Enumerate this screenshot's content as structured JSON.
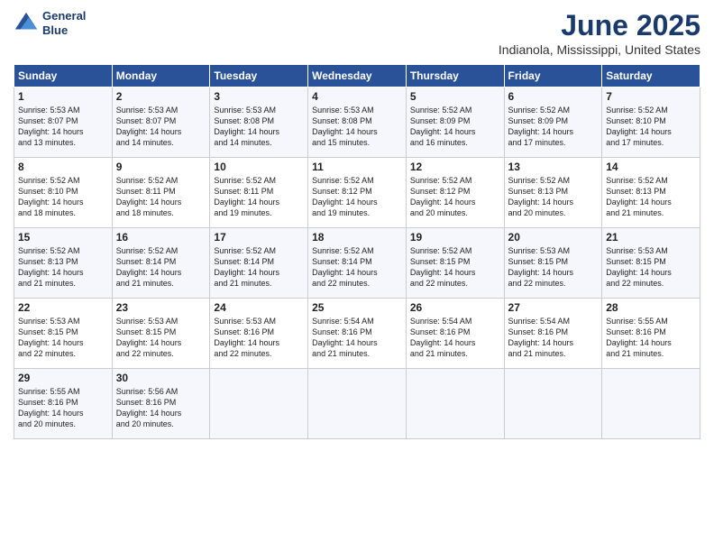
{
  "header": {
    "logo_line1": "General",
    "logo_line2": "Blue",
    "month_title": "June 2025",
    "location": "Indianola, Mississippi, United States"
  },
  "days_of_week": [
    "Sunday",
    "Monday",
    "Tuesday",
    "Wednesday",
    "Thursday",
    "Friday",
    "Saturday"
  ],
  "weeks": [
    [
      {
        "day": "1",
        "text": "Sunrise: 5:53 AM\nSunset: 8:07 PM\nDaylight: 14 hours\nand 13 minutes."
      },
      {
        "day": "2",
        "text": "Sunrise: 5:53 AM\nSunset: 8:07 PM\nDaylight: 14 hours\nand 14 minutes."
      },
      {
        "day": "3",
        "text": "Sunrise: 5:53 AM\nSunset: 8:08 PM\nDaylight: 14 hours\nand 14 minutes."
      },
      {
        "day": "4",
        "text": "Sunrise: 5:53 AM\nSunset: 8:08 PM\nDaylight: 14 hours\nand 15 minutes."
      },
      {
        "day": "5",
        "text": "Sunrise: 5:52 AM\nSunset: 8:09 PM\nDaylight: 14 hours\nand 16 minutes."
      },
      {
        "day": "6",
        "text": "Sunrise: 5:52 AM\nSunset: 8:09 PM\nDaylight: 14 hours\nand 17 minutes."
      },
      {
        "day": "7",
        "text": "Sunrise: 5:52 AM\nSunset: 8:10 PM\nDaylight: 14 hours\nand 17 minutes."
      }
    ],
    [
      {
        "day": "8",
        "text": "Sunrise: 5:52 AM\nSunset: 8:10 PM\nDaylight: 14 hours\nand 18 minutes."
      },
      {
        "day": "9",
        "text": "Sunrise: 5:52 AM\nSunset: 8:11 PM\nDaylight: 14 hours\nand 18 minutes."
      },
      {
        "day": "10",
        "text": "Sunrise: 5:52 AM\nSunset: 8:11 PM\nDaylight: 14 hours\nand 19 minutes."
      },
      {
        "day": "11",
        "text": "Sunrise: 5:52 AM\nSunset: 8:12 PM\nDaylight: 14 hours\nand 19 minutes."
      },
      {
        "day": "12",
        "text": "Sunrise: 5:52 AM\nSunset: 8:12 PM\nDaylight: 14 hours\nand 20 minutes."
      },
      {
        "day": "13",
        "text": "Sunrise: 5:52 AM\nSunset: 8:13 PM\nDaylight: 14 hours\nand 20 minutes."
      },
      {
        "day": "14",
        "text": "Sunrise: 5:52 AM\nSunset: 8:13 PM\nDaylight: 14 hours\nand 21 minutes."
      }
    ],
    [
      {
        "day": "15",
        "text": "Sunrise: 5:52 AM\nSunset: 8:13 PM\nDaylight: 14 hours\nand 21 minutes."
      },
      {
        "day": "16",
        "text": "Sunrise: 5:52 AM\nSunset: 8:14 PM\nDaylight: 14 hours\nand 21 minutes."
      },
      {
        "day": "17",
        "text": "Sunrise: 5:52 AM\nSunset: 8:14 PM\nDaylight: 14 hours\nand 21 minutes."
      },
      {
        "day": "18",
        "text": "Sunrise: 5:52 AM\nSunset: 8:14 PM\nDaylight: 14 hours\nand 22 minutes."
      },
      {
        "day": "19",
        "text": "Sunrise: 5:52 AM\nSunset: 8:15 PM\nDaylight: 14 hours\nand 22 minutes."
      },
      {
        "day": "20",
        "text": "Sunrise: 5:53 AM\nSunset: 8:15 PM\nDaylight: 14 hours\nand 22 minutes."
      },
      {
        "day": "21",
        "text": "Sunrise: 5:53 AM\nSunset: 8:15 PM\nDaylight: 14 hours\nand 22 minutes."
      }
    ],
    [
      {
        "day": "22",
        "text": "Sunrise: 5:53 AM\nSunset: 8:15 PM\nDaylight: 14 hours\nand 22 minutes."
      },
      {
        "day": "23",
        "text": "Sunrise: 5:53 AM\nSunset: 8:15 PM\nDaylight: 14 hours\nand 22 minutes."
      },
      {
        "day": "24",
        "text": "Sunrise: 5:53 AM\nSunset: 8:16 PM\nDaylight: 14 hours\nand 22 minutes."
      },
      {
        "day": "25",
        "text": "Sunrise: 5:54 AM\nSunset: 8:16 PM\nDaylight: 14 hours\nand 21 minutes."
      },
      {
        "day": "26",
        "text": "Sunrise: 5:54 AM\nSunset: 8:16 PM\nDaylight: 14 hours\nand 21 minutes."
      },
      {
        "day": "27",
        "text": "Sunrise: 5:54 AM\nSunset: 8:16 PM\nDaylight: 14 hours\nand 21 minutes."
      },
      {
        "day": "28",
        "text": "Sunrise: 5:55 AM\nSunset: 8:16 PM\nDaylight: 14 hours\nand 21 minutes."
      }
    ],
    [
      {
        "day": "29",
        "text": "Sunrise: 5:55 AM\nSunset: 8:16 PM\nDaylight: 14 hours\nand 20 minutes."
      },
      {
        "day": "30",
        "text": "Sunrise: 5:56 AM\nSunset: 8:16 PM\nDaylight: 14 hours\nand 20 minutes."
      },
      {
        "day": "",
        "text": ""
      },
      {
        "day": "",
        "text": ""
      },
      {
        "day": "",
        "text": ""
      },
      {
        "day": "",
        "text": ""
      },
      {
        "day": "",
        "text": ""
      }
    ]
  ]
}
